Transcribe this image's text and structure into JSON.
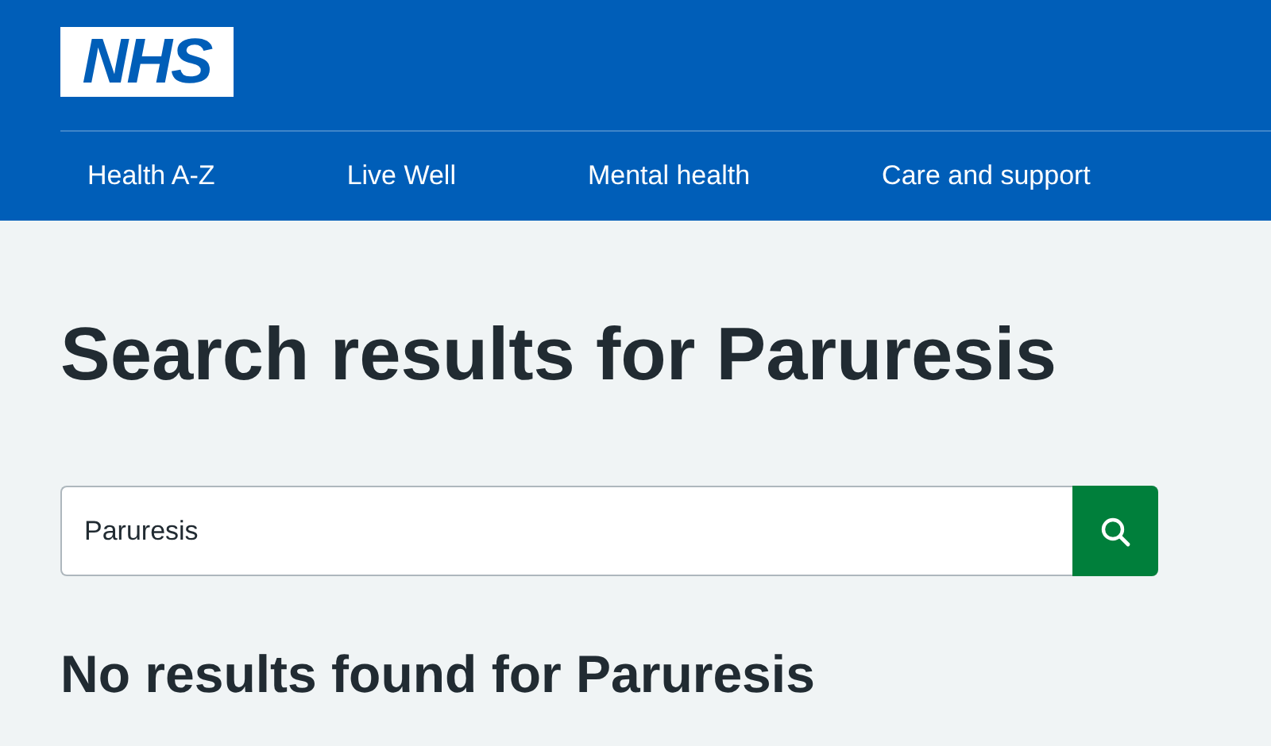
{
  "header": {
    "logo": "NHS",
    "nav": [
      {
        "label": "Health A-Z"
      },
      {
        "label": "Live Well"
      },
      {
        "label": "Mental health"
      },
      {
        "label": "Care and support"
      }
    ]
  },
  "title": "Search results for Paruresis",
  "search": {
    "value": "Paruresis"
  },
  "message": "No results found for Paruresis"
}
